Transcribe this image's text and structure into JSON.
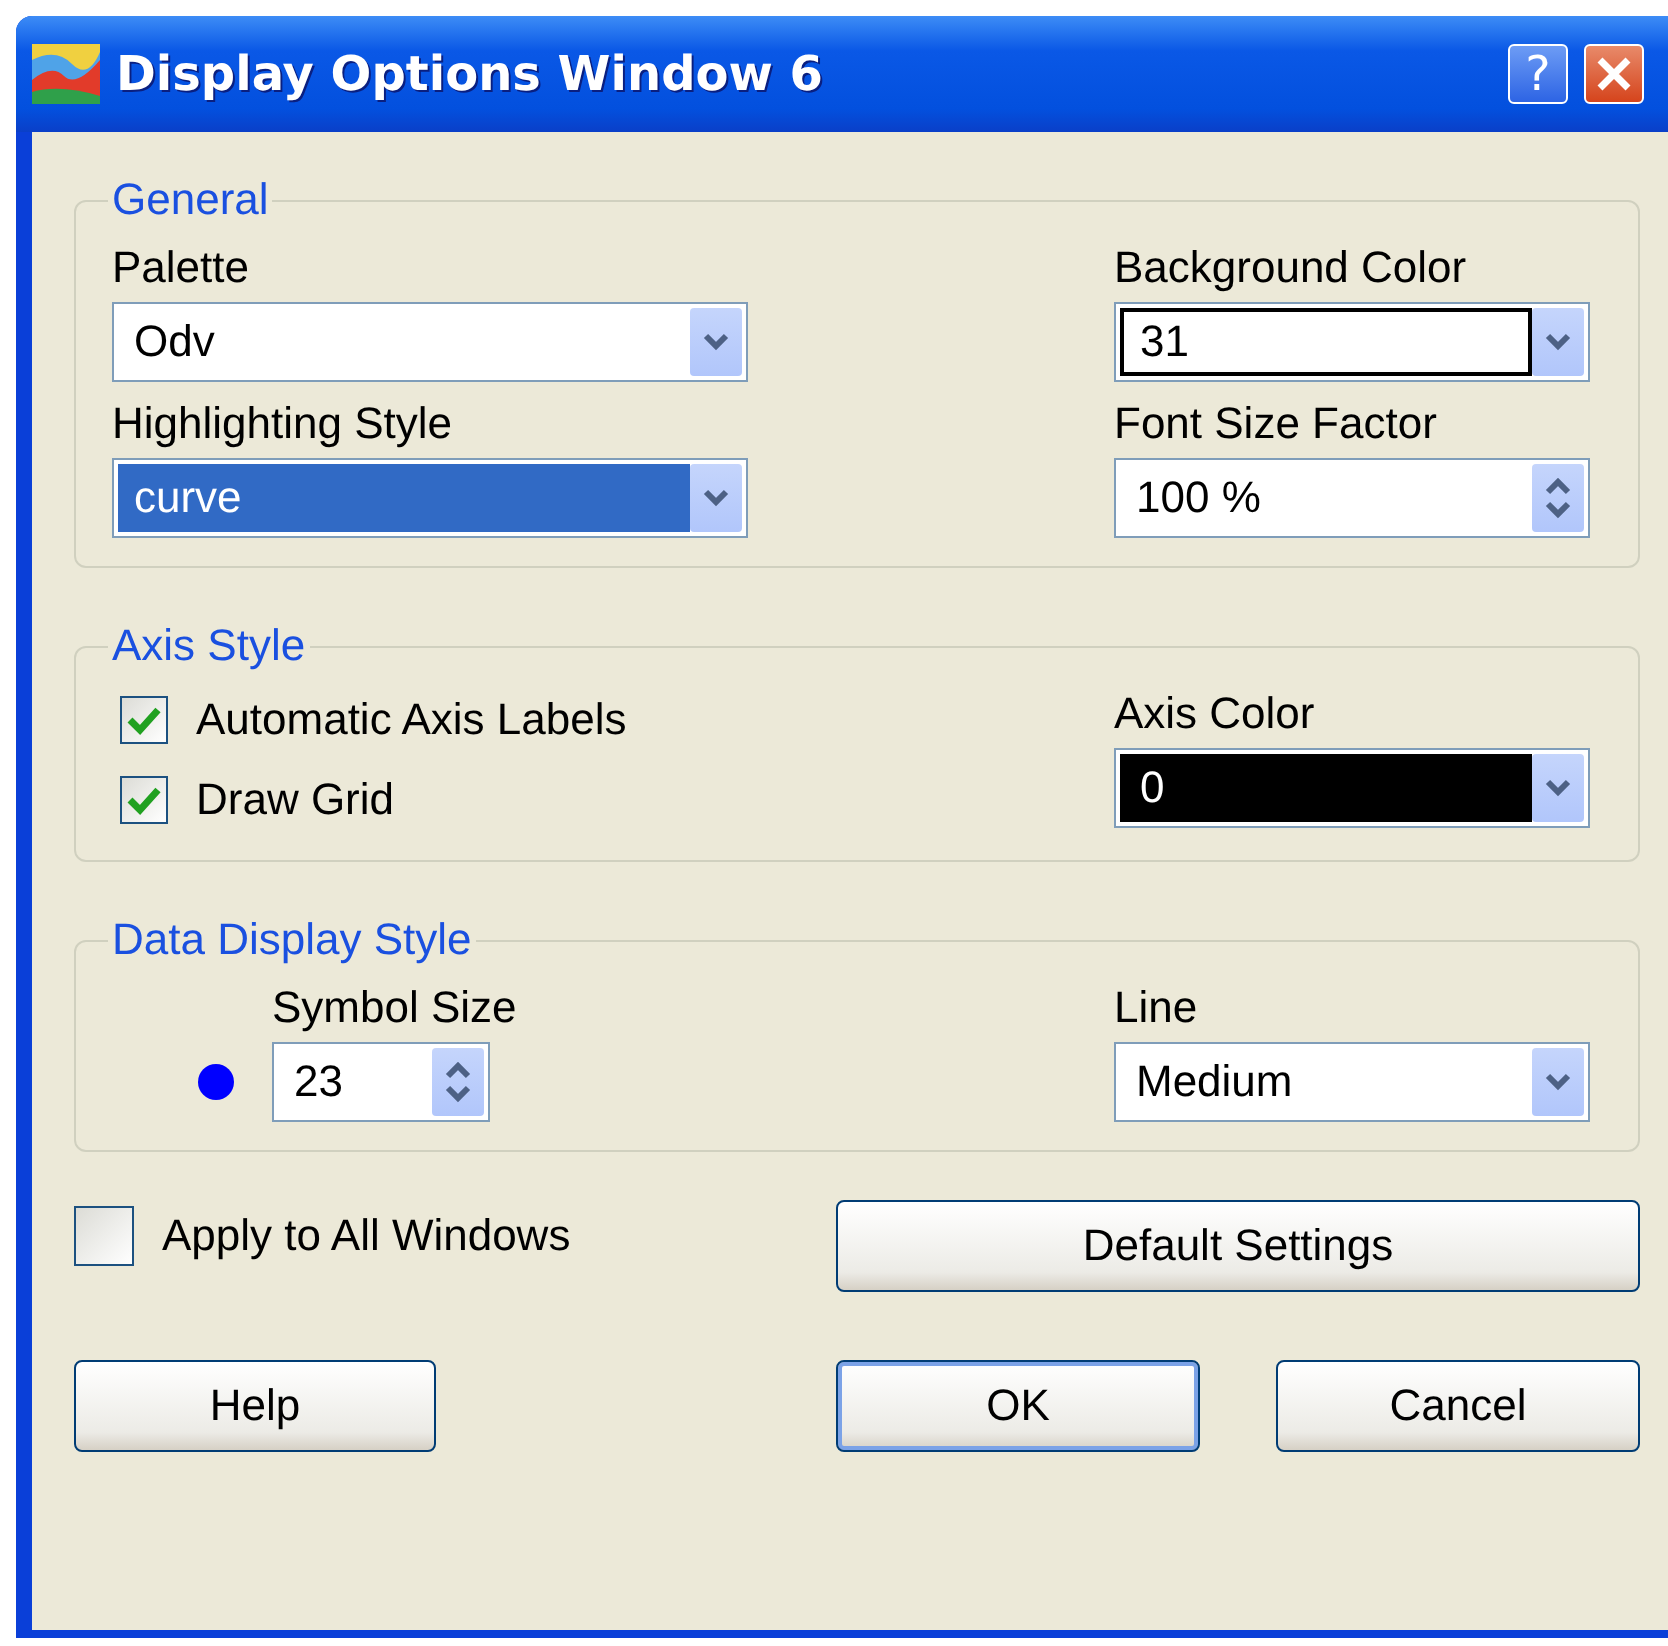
{
  "window": {
    "title": "Display Options Window 6",
    "help_button": "?"
  },
  "groups": [
    {
      "legend": "General",
      "left": [
        {
          "kind": "select",
          "label": "Palette",
          "value": "Odv",
          "selected": false
        },
        {
          "kind": "select",
          "label": "Highlighting Style",
          "value": "curve",
          "selected": true
        }
      ],
      "right": [
        {
          "kind": "color",
          "label": "Background Color",
          "value": "31",
          "color": "#ffffff"
        },
        {
          "kind": "spinner",
          "label": "Font Size Factor",
          "value": "100 %"
        }
      ]
    },
    {
      "legend": "Axis Style",
      "left": [
        {
          "kind": "checkbox",
          "label": "Automatic Axis Labels",
          "checked": true
        },
        {
          "kind": "checkbox",
          "label": "Draw Grid",
          "checked": true
        }
      ],
      "right": [
        {
          "kind": "color",
          "label": "Axis Color",
          "value": "0",
          "color": "#000000"
        }
      ]
    },
    {
      "legend": "Data Display Style",
      "left": [
        {
          "kind": "symbol",
          "label": "Symbol Size",
          "value": "23",
          "color": "#0000ff"
        }
      ],
      "right": [
        {
          "kind": "select",
          "label": "Line",
          "value": "Medium",
          "selected": false
        }
      ]
    }
  ],
  "apply_all": {
    "label": "Apply to All Windows",
    "checked": false
  },
  "default_button": "Default Settings",
  "buttons": [
    {
      "label": "Help",
      "default": false
    },
    {
      "label": "OK",
      "default": true
    },
    {
      "label": "Cancel",
      "default": false
    }
  ]
}
